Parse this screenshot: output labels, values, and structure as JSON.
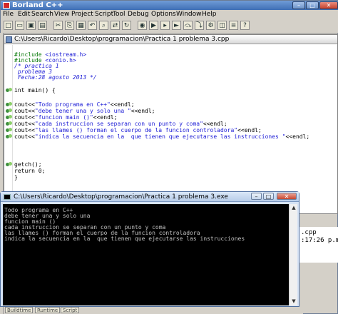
{
  "app": {
    "title": "Borland C++"
  },
  "menu": [
    "File",
    "Edit",
    "Search",
    "View",
    "Project",
    "Script",
    "Tool",
    "Debug",
    "Options",
    "Window",
    "Help"
  ],
  "toolbar_icons": [
    "new-file-icon",
    "open-icon",
    "save-icon",
    "save-all-icon",
    "cut-icon",
    "copy-icon",
    "paste-icon",
    "undo-icon",
    "find-icon",
    "replace-icon",
    "search-again-icon",
    "browse-icon",
    "make-icon",
    "build-icon",
    "run-icon",
    "step-over-icon",
    "trace-into-icon",
    "compile-icon",
    "project-icon",
    "message-icon",
    "help-icon"
  ],
  "editor": {
    "title": "C:\\Users\\Ricardo\\Desktop\\programacion\\Practica 1 problema 3.cpp",
    "lines": [
      {
        "parts": [
          [
            "pp",
            "#include "
          ],
          [
            "str",
            "<iostream.h>"
          ]
        ]
      },
      {
        "parts": [
          [
            "pp",
            "#include "
          ],
          [
            "str",
            "<conio.h>"
          ]
        ]
      },
      {
        "parts": [
          [
            "cmt",
            "/* practica 1"
          ]
        ]
      },
      {
        "parts": [
          [
            "cmt",
            " problema 3"
          ]
        ]
      },
      {
        "parts": [
          [
            "cmt",
            " Fecha:28 agosto 2013 */"
          ]
        ]
      },
      {
        "parts": [
          [
            "txt",
            ""
          ]
        ]
      },
      {
        "parts": [
          [
            "txt",
            "int main() {"
          ]
        ]
      },
      {
        "parts": [
          [
            "txt",
            ""
          ]
        ]
      },
      {
        "parts": [
          [
            "txt",
            "cout<<"
          ],
          [
            "str",
            "\"Todo programa en C++\""
          ],
          [
            "txt",
            "<<endl;"
          ]
        ]
      },
      {
        "parts": [
          [
            "txt",
            "cout<<"
          ],
          [
            "str",
            "\"debe tener una y solo una \""
          ],
          [
            "txt",
            "<<endl;"
          ]
        ]
      },
      {
        "parts": [
          [
            "txt",
            "cout<<"
          ],
          [
            "str",
            "\"funcion main ()\""
          ],
          [
            "txt",
            "<<endl;"
          ]
        ]
      },
      {
        "parts": [
          [
            "txt",
            "cout<<"
          ],
          [
            "str",
            "\"cada instruccion se separan con un punto y coma\""
          ],
          [
            "txt",
            "<<endl;"
          ]
        ]
      },
      {
        "parts": [
          [
            "txt",
            "cout<<"
          ],
          [
            "str",
            "\"las llames () forman el cuerpo de la funcion controladora\""
          ],
          [
            "txt",
            "<<endl;"
          ]
        ]
      },
      {
        "parts": [
          [
            "txt",
            "cout<<"
          ],
          [
            "str",
            "\"indica la secuencia en la  que tienen que ejecutarse las instrucciones \""
          ],
          [
            "txt",
            "<<endl;"
          ]
        ]
      },
      {
        "parts": [
          [
            "txt",
            ""
          ]
        ]
      },
      {
        "parts": [
          [
            "txt",
            ""
          ]
        ]
      },
      {
        "parts": [
          [
            "txt",
            ""
          ]
        ]
      },
      {
        "parts": [
          [
            "txt",
            "getch();"
          ]
        ]
      },
      {
        "parts": [
          [
            "txt",
            "return 0;"
          ]
        ]
      },
      {
        "parts": [
          [
            "txt",
            "}"
          ]
        ]
      }
    ]
  },
  "console": {
    "title": "C:\\Users\\Ricardo\\Desktop\\programacion\\Practica 1 problema 3.exe",
    "lines": [
      "Todo programa en C++",
      "debe tener una y solo una",
      "funcion main ()",
      "cada instruccion se separan con un punto y coma",
      "las llames () forman el cuerpo de la funcion controladora",
      "indica la secuencia en la  que tienen que ejecutarse las instrucciones"
    ]
  },
  "right_panel": {
    "line1": ".cpp",
    "line2": ":17:26 p.m"
  },
  "bottom_tabs": [
    "Buildtime",
    "Runtime",
    "Script"
  ]
}
